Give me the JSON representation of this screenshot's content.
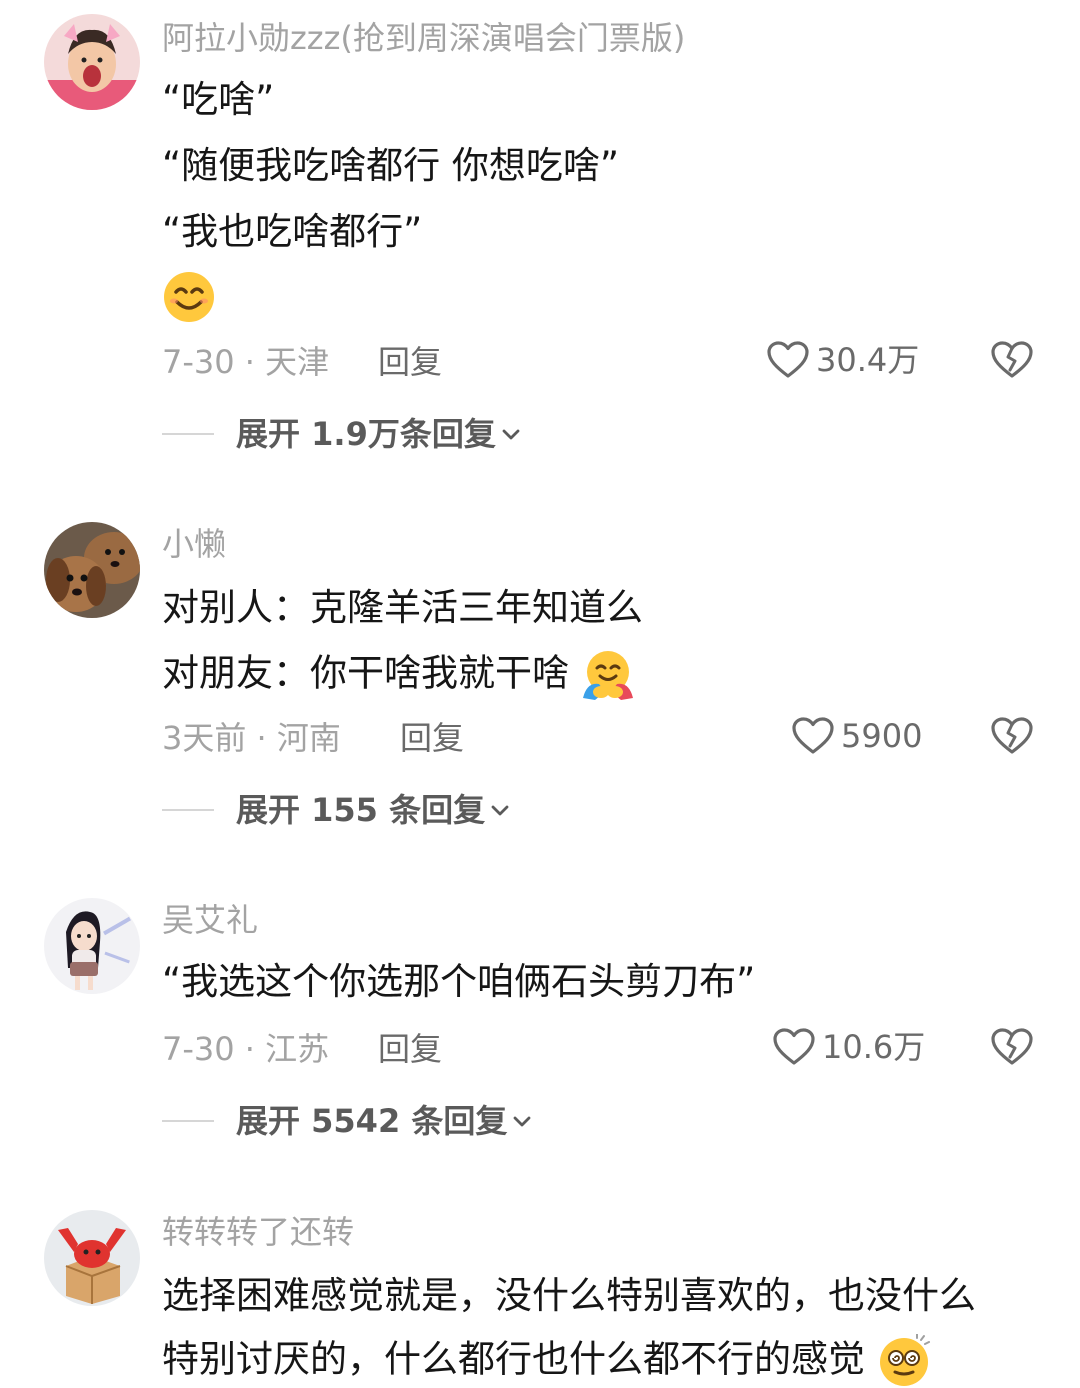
{
  "comments": [
    {
      "username": "阿拉小勋zzz(抢到周深演唱会门票版)",
      "lines": [
        "“吃啥”",
        "“随便我吃啥都行 你想吃啥”",
        "“我也吃啥都行”"
      ],
      "emoji": "smiling-face-emoji",
      "date_location": "7-30 · 天津",
      "reply_label": "回复",
      "likes": "30.4万",
      "expand_label": "展开 1.9万条回复"
    },
    {
      "username": "小懒",
      "lines": [
        "对别人：克隆羊活三年知道么",
        "对朋友：你干啥我就干啥"
      ],
      "emoji": "hugging-face-emoji",
      "date_location": "3天前 · 河南",
      "reply_label": "回复",
      "likes": "5900",
      "expand_label": "展开 155 条回复"
    },
    {
      "username": "吴艾礼",
      "lines": [
        "“我选这个你选那个咱俩石头剪刀布”"
      ],
      "date_location": "7-30 · 江苏",
      "reply_label": "回复",
      "likes": "10.6万",
      "expand_label": "展开 5542 条回复"
    },
    {
      "username": "转转转了还转",
      "lines": [
        "选择困难感觉就是，没什么特别喜欢的，也没什么",
        "特别讨厌的，什么都行也什么都不行的感觉"
      ],
      "emoji": "dizzy-face-emoji"
    }
  ],
  "colors": {
    "text_primary": "#161616",
    "text_secondary": "#a3a3a3",
    "action_gray": "#6a6a6a"
  },
  "icons": {
    "like": "heart-outline-icon",
    "dislike": "broken-heart-icon",
    "expand": "chevron-down-icon"
  }
}
